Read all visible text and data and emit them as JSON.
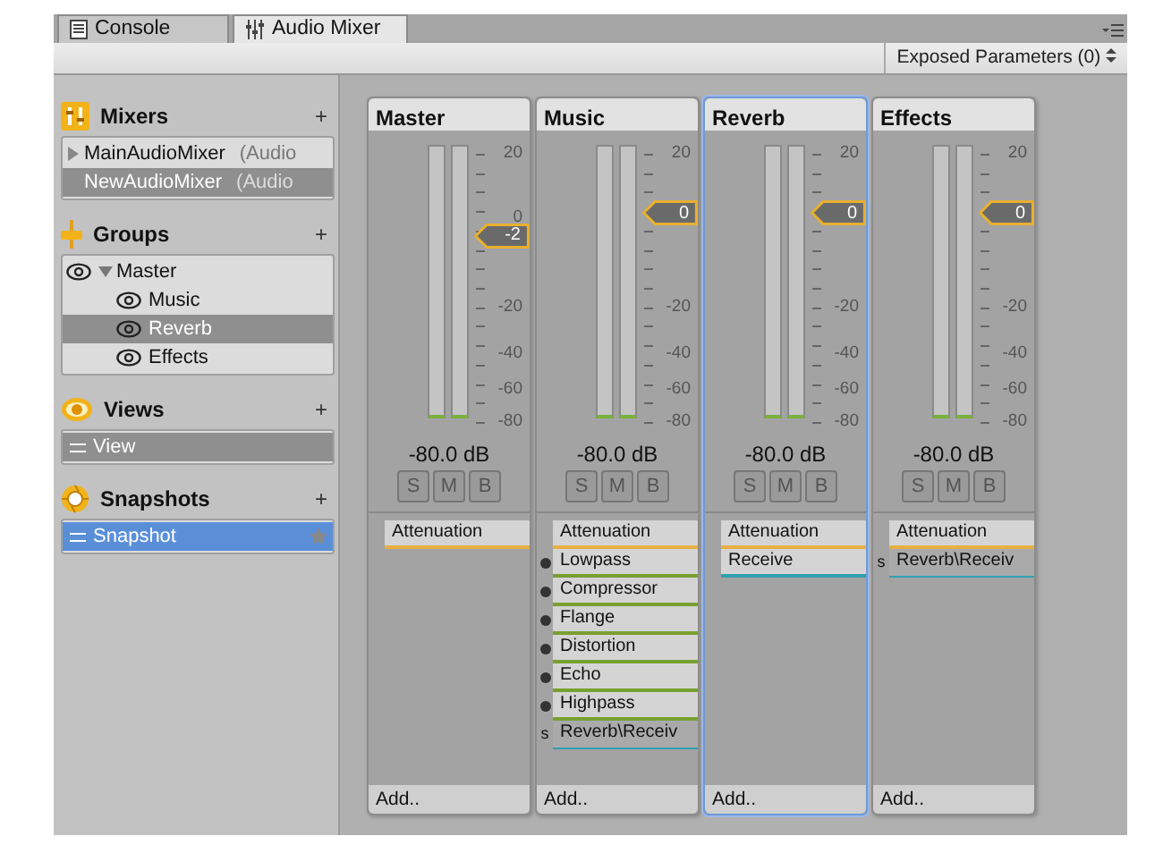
{
  "tabs": [
    {
      "label": "Console",
      "selected": false
    },
    {
      "label": "Audio Mixer",
      "selected": true
    }
  ],
  "toolbar": {
    "exposed_parameters": "Exposed Parameters (0)"
  },
  "sidebar": {
    "sections": [
      {
        "title": "Mixers",
        "add": "+",
        "kind": "mixers",
        "items": [
          {
            "name": "MainAudioMixer",
            "type": "(Audio",
            "expanded": false,
            "selected": false
          },
          {
            "name": "NewAudioMixer",
            "type": "(Audio",
            "selected": true
          }
        ]
      },
      {
        "title": "Groups",
        "add": "+",
        "kind": "groups",
        "items": [
          {
            "name": "Master",
            "expanded": true,
            "selected": false,
            "children": [
              {
                "name": "Music",
                "selected": false
              },
              {
                "name": "Reverb",
                "selected": true
              },
              {
                "name": "Effects",
                "selected": false
              }
            ]
          }
        ]
      },
      {
        "title": "Views",
        "add": "+",
        "kind": "views",
        "items": [
          {
            "name": "View",
            "selected": true
          }
        ]
      },
      {
        "title": "Snapshots",
        "add": "+",
        "kind": "snapshots",
        "items": [
          {
            "name": "Snapshot",
            "selected": true,
            "starred": true
          }
        ]
      }
    ]
  },
  "strips": [
    {
      "title": "Master",
      "selected": false,
      "scale_max": "20",
      "scale_unity": "0",
      "scale": [
        "-20",
        "-40",
        "-60",
        "-80"
      ],
      "fader": {
        "value": "-2",
        "level": 0.667
      },
      "db": "-80.0 dB",
      "buttons": [
        "S",
        "M",
        "B"
      ],
      "effects": [
        {
          "kind": "attenuation",
          "name": "Attenuation",
          "color": "#e8b040"
        }
      ],
      "add": "Add.."
    },
    {
      "title": "Music",
      "selected": false,
      "scale_max": "20",
      "scale": [
        "-20",
        "-40",
        "-60",
        "-80"
      ],
      "fader": {
        "value": "0",
        "level": 0.75
      },
      "db": "-80.0 dB",
      "buttons": [
        "S",
        "M",
        "B"
      ],
      "effects": [
        {
          "kind": "attenuation",
          "name": "Attenuation",
          "color": "#e8b040"
        },
        {
          "kind": "effect",
          "name": "Lowpass",
          "color": "#78a030"
        },
        {
          "kind": "effect",
          "name": "Compressor",
          "color": "#78a030"
        },
        {
          "kind": "effect",
          "name": "Flange",
          "color": "#78a030"
        },
        {
          "kind": "effect",
          "name": "Distortion",
          "color": "#78a030"
        },
        {
          "kind": "effect",
          "name": "Echo",
          "color": "#78a030"
        },
        {
          "kind": "effect",
          "name": "Highpass",
          "color": "#78a030"
        },
        {
          "kind": "send",
          "prefix": "s",
          "name": "Reverb\\Receiv",
          "color": "#30a0b0"
        }
      ],
      "add": "Add.."
    },
    {
      "title": "Reverb",
      "selected": true,
      "scale_max": "20",
      "scale": [
        "-20",
        "-40",
        "-60",
        "-80"
      ],
      "fader": {
        "value": "0",
        "level": 0.75
      },
      "db": "-80.0 dB",
      "buttons": [
        "S",
        "M",
        "B"
      ],
      "effects": [
        {
          "kind": "attenuation",
          "name": "Attenuation",
          "color": "#e8b040"
        },
        {
          "kind": "receive",
          "name": "Receive",
          "color": "#30a0b0"
        }
      ],
      "add": "Add.."
    },
    {
      "title": "Effects",
      "selected": false,
      "scale_max": "20",
      "scale": [
        "-20",
        "-40",
        "-60",
        "-80"
      ],
      "fader": {
        "value": "0",
        "level": 0.75
      },
      "db": "-80.0 dB",
      "buttons": [
        "S",
        "M",
        "B"
      ],
      "effects": [
        {
          "kind": "attenuation",
          "name": "Attenuation",
          "color": "#e8b040"
        },
        {
          "kind": "send",
          "prefix": "s",
          "name": "Reverb\\Receiv",
          "color": "#30a0b0"
        }
      ],
      "add": "Add.."
    }
  ]
}
